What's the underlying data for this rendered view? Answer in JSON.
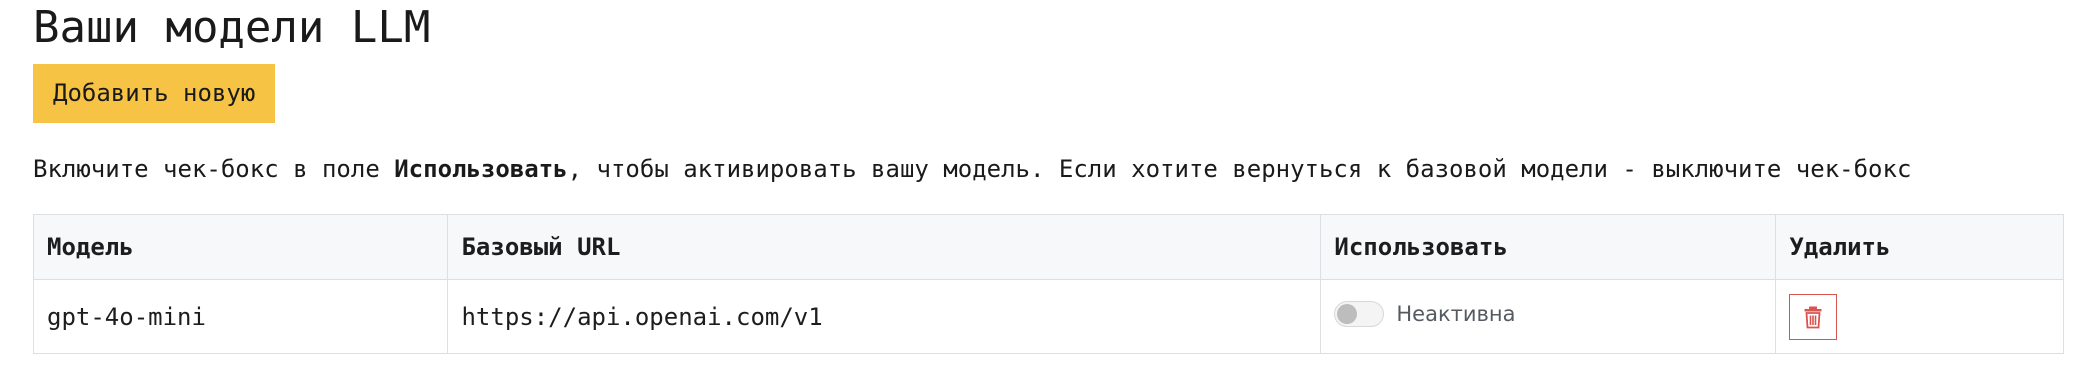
{
  "page": {
    "title": "Ваши модели LLM",
    "add_button_label": "Добавить новую",
    "hint": {
      "before": "Включите чек-бокс в поле ",
      "emphasis": "Использовать",
      "after": ", чтобы активировать вашу модель. Если хотите вернуться к базовой модели - выключите чек-бокс"
    }
  },
  "table": {
    "headers": {
      "model": "Модель",
      "base_url": "Базовый URL",
      "use": "Использовать",
      "delete": "Удалить"
    },
    "rows": [
      {
        "model": "gpt-4o-mini",
        "base_url": "https://api.openai.com/v1",
        "active": false,
        "status_label": "Неактивна",
        "delete_icon": "trash-icon"
      }
    ]
  },
  "colors": {
    "accent_button": "#f7c344",
    "delete_red": "#d9534f",
    "header_bg": "#f7f8fa",
    "border": "#dedfe3"
  }
}
